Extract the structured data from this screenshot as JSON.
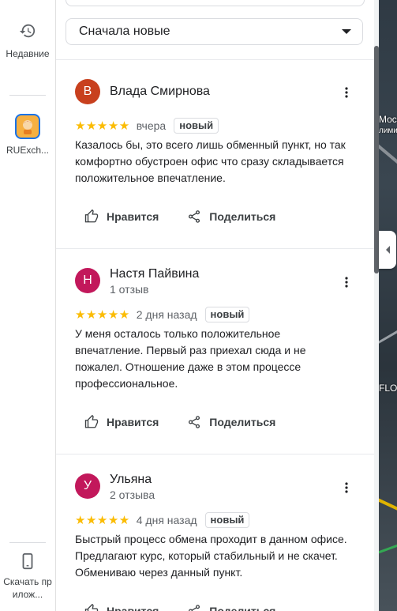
{
  "rail": {
    "recent_label": "Недавние",
    "app_label": "RUExch...",
    "download_label": "Скачать прилож..."
  },
  "sort": {
    "selected": "Сначала новые"
  },
  "actions": {
    "like_label": "Нравится",
    "share_label": "Поделиться"
  },
  "reviews": [
    {
      "avatar_letter": "В",
      "avatar_color": "#c8401e",
      "author": "Влада Смирнова",
      "author_sub": "",
      "stars": "★★★★★",
      "rating": 5,
      "when": "вчера",
      "badge": "новый",
      "text": "Казалось бы, это всего лишь обменный пункт, но так комфортно обустроен офис что сразу складывается положительное впечатление."
    },
    {
      "avatar_letter": "Н",
      "avatar_color": "#c2185b",
      "author": "Настя Пайвина",
      "author_sub": "1 отзыв",
      "stars": "★★★★★",
      "rating": 5,
      "when": "2 дня назад",
      "badge": "новый",
      "text": "У меня осталось только положительное впечатление. Первый раз приехал сюда и не пожалел. Отношение даже в этом процессе профессиональное."
    },
    {
      "avatar_letter": "У",
      "avatar_color": "#c2185b",
      "author": "Ульяна",
      "author_sub": "2 отзыва",
      "stars": "★★★★★",
      "rating": 5,
      "when": "4 дня назад",
      "badge": "новый",
      "text": "Быстрый процесс обмена проходит в данном офисе. Предлагают курс, который стабильный и не скачет. Обмениваю через данный пункт."
    }
  ],
  "map": {
    "label1": "Моск",
    "label2": "лими",
    "label3": "FLOW"
  },
  "colors": {
    "star": "#fbbc04",
    "accent": "#1a73e8"
  }
}
